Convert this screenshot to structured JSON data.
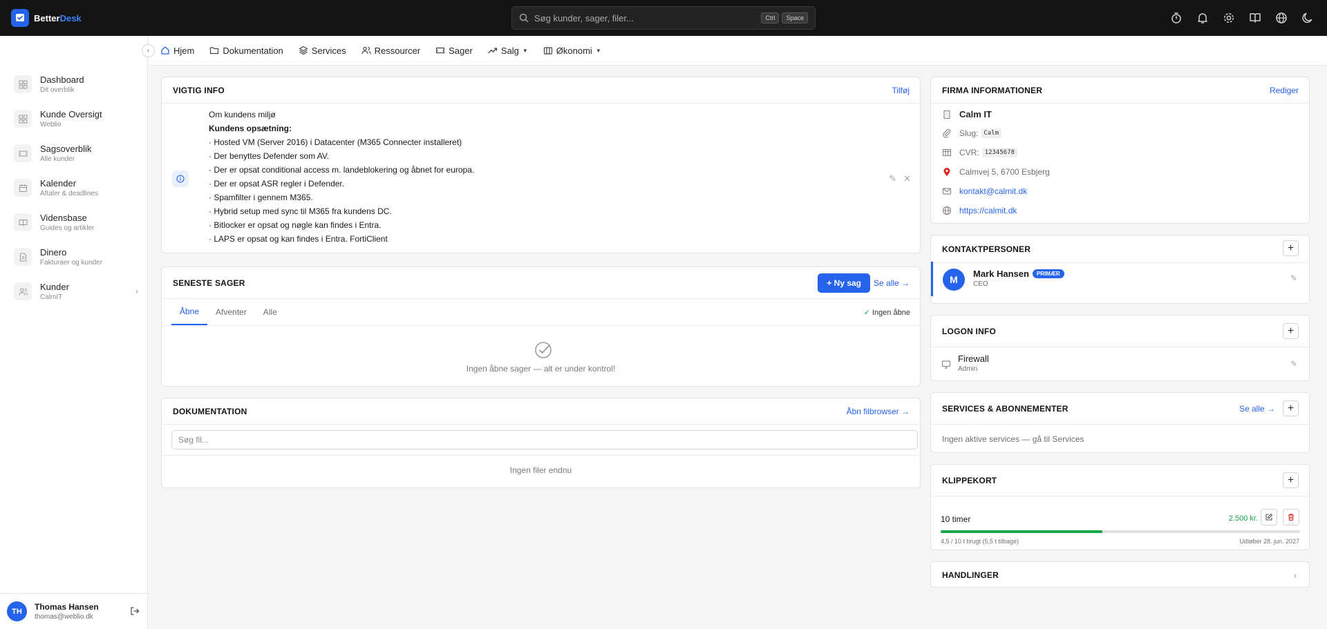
{
  "app": {
    "brand_part1": "Better",
    "brand_part2": "Desk",
    "search_placeholder": "Søg kunder, sager, filer...",
    "shortcut_key1": "Ctrl",
    "shortcut_key2": "Space",
    "accent": "#2563eb"
  },
  "top_icons": [
    "timer-icon",
    "bell-icon",
    "gear-icon",
    "book-icon",
    "globe-icon",
    "moon-icon"
  ],
  "sidebar": {
    "items": [
      {
        "title": "Dashboard",
        "subtitle": "Dit overblik",
        "icon": "grid-icon"
      },
      {
        "title": "Kunde Oversigt",
        "subtitle": "Weblio",
        "icon": "grid-icon"
      },
      {
        "title": "Sagsoverblik",
        "subtitle": "Alle kunder",
        "icon": "ticket-icon"
      },
      {
        "title": "Kalender",
        "subtitle": "Aftaler & deadlines",
        "icon": "calendar-icon"
      },
      {
        "title": "Vidensbase",
        "subtitle": "Guides og artikler",
        "icon": "book-icon"
      },
      {
        "title": "Dinero",
        "subtitle": "Fakturaer og kunder",
        "icon": "invoice-icon"
      },
      {
        "title": "Kunder",
        "subtitle": "CalmIT",
        "icon": "users-icon"
      }
    ],
    "user": {
      "initials": "TH",
      "name": "Thomas Hansen",
      "email": "thomas@weblio.dk"
    }
  },
  "subnav": {
    "items": [
      {
        "label": "Hjem",
        "icon": "home-icon"
      },
      {
        "label": "Dokumentation",
        "icon": "folder-icon"
      },
      {
        "label": "Services",
        "icon": "layers-icon"
      },
      {
        "label": "Ressourcer",
        "icon": "users-icon"
      },
      {
        "label": "Sager",
        "icon": "ticket-icon"
      },
      {
        "label": "Salg",
        "icon": "trend-icon"
      },
      {
        "label": "Økonomi",
        "icon": "bank-icon"
      }
    ]
  },
  "vigtig_info": {
    "title": "VIGTIG INFO",
    "action": "Tilføj",
    "heading": "Om kundens miljø",
    "subheading": "Kundens opsætning:",
    "lines": [
      "· Hosted VM (Server 2016) i Datacenter (M365 Connecter installeret)",
      "· Der benyttes Defender som AV.",
      "· Der er opsat conditional access m. landeblokering og åbnet for europa.",
      "· Der er opsat ASR regler i Defender.",
      "· Spamfilter i gennem M365.",
      "· Hybrid setup med sync til M365 fra kundens DC.",
      "· Bitlocker er opsat og nøgle kan findes i Entra.",
      "· LAPS er opsat og kan findes i Entra. FortiClient"
    ]
  },
  "seneste_sager": {
    "title": "SENESTE SAGER",
    "new_button": "+ Ny sag",
    "see_all": "Se alle →",
    "tabs": [
      "Åbne",
      "Afventer",
      "Alle"
    ],
    "status_check": "✓",
    "status_text": "Ingen åbne",
    "empty_text": "Ingen åbne sager — alt er under kontrol!"
  },
  "dokumentation": {
    "title": "DOKUMENTATION",
    "action": "Åbn filbrowser →",
    "search_placeholder": "Søg fil...",
    "empty_text": "Ingen filer endnu"
  },
  "firma": {
    "title": "FIRMA INFORMATIONER",
    "action": "Rediger",
    "name": "Calm IT",
    "slug_label": "Slug:",
    "slug_value": "Calm",
    "cvr_label": "CVR:",
    "cvr_value": "12345678",
    "address": "Calmvej 5, 6700 Esbjerg",
    "email": "kontakt@calmit.dk",
    "website": "https://calmit.dk"
  },
  "kontaktpersoner": {
    "title": "KONTAKTPERSONER",
    "contact": {
      "initial": "M",
      "name": "Mark Hansen",
      "badge": "PRIMÆR",
      "role": "CEO"
    }
  },
  "logon": {
    "title": "LOGON INFO",
    "entry_name": "Firewall",
    "entry_user": "Admin"
  },
  "services": {
    "title": "SERVICES & ABONNEMENTER",
    "see_all": "Se alle →",
    "empty_text": "Ingen aktive services — gå til Services"
  },
  "klippekort": {
    "title": "KLIPPEKORT",
    "name": "10 timer",
    "price": "2.500 kr.",
    "used_text": "4,5 / 10 t brugt (5,5 t tilbage)",
    "used_fraction": 0.45,
    "expiry": "Udløber 28. jun. 2027"
  },
  "handlinger": {
    "title": "HANDLINGER"
  }
}
